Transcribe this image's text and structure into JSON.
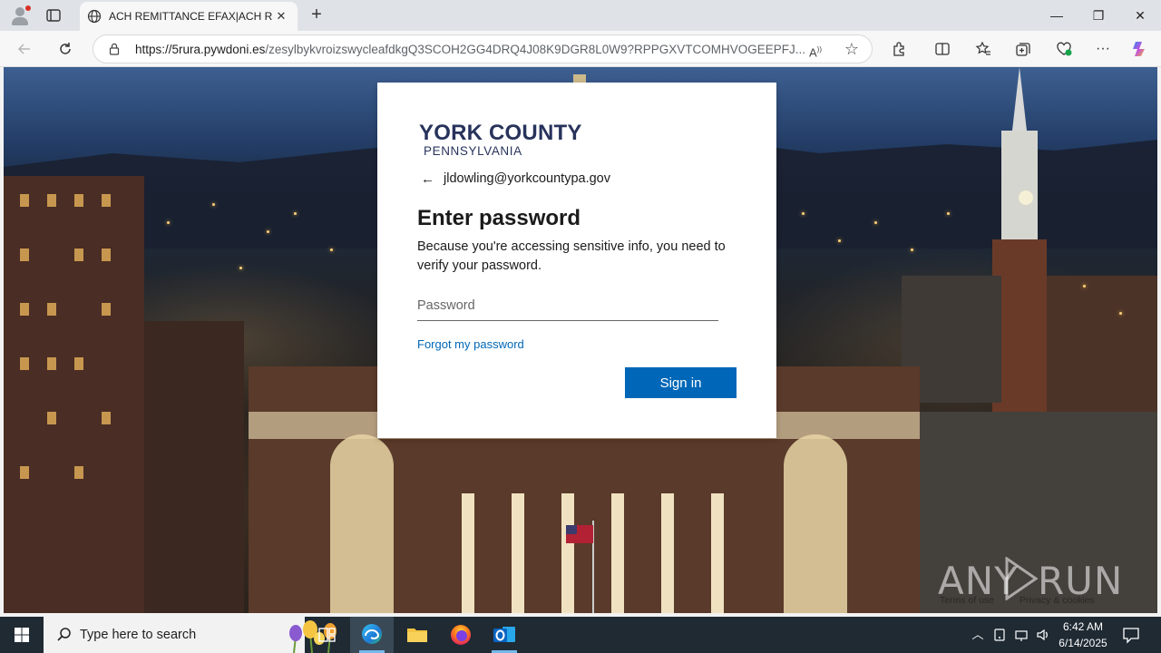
{
  "browser": {
    "tab": {
      "title": "ACH REMITTANCE EFAX|ACH REMITTANCE EFAX",
      "close_glyph": "✕",
      "icon": "globe-icon"
    },
    "new_tab_glyph": "+",
    "window_controls": {
      "minimize": "—",
      "restore": "❐",
      "close": "✕"
    },
    "address_bar": {
      "host": "https://5rura.pywdoni.es",
      "path": "/zesylbykvroizswycleafdkgQ3SCOH2GG4DRQ4J08K9DGR8L0W9?RPPGXVTCOMHVOGEEPFJ..."
    },
    "toolbar_icons": [
      "back-icon",
      "refresh-icon",
      "lock-icon",
      "read-aloud-icon",
      "favorite-star-icon",
      "extensions-icon",
      "split-screen-icon",
      "favorites-icon",
      "collections-icon",
      "browser-essentials-icon",
      "more-icon",
      "copilot-icon"
    ]
  },
  "login": {
    "logo": {
      "line1": "YORK COUNTY",
      "line2": "PENNSYLVANIA"
    },
    "back_glyph": "←",
    "email": "jldowling@yorkcountypa.gov",
    "heading": "Enter password",
    "description": "Because you're accessing sensitive info, you need to verify your password.",
    "password_placeholder": "Password",
    "forgot_link": "Forgot my password",
    "signin_button": "Sign in",
    "colors": {
      "brand": "#28335c",
      "accent": "#0067b8"
    }
  },
  "footer": {
    "terms": "Terms of use",
    "privacy": "Privacy & cookies"
  },
  "watermark": {
    "left": "ANY",
    "right": "RUN"
  },
  "taskbar": {
    "search_placeholder": "Type here to search",
    "apps": [
      "task-view-icon",
      "edge-icon",
      "file-explorer-icon",
      "firefox-icon",
      "outlook-icon"
    ],
    "active_app": "edge-icon",
    "time": "6:42 AM",
    "date": "6/14/2025"
  }
}
